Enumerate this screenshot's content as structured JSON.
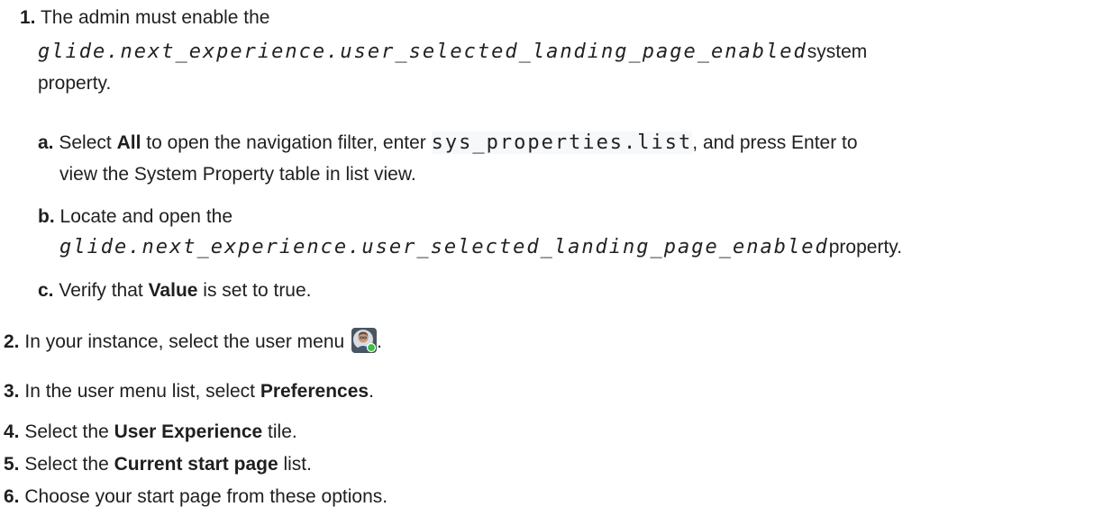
{
  "steps": {
    "s1": {
      "num": "1.",
      "text_a": "The admin must enable the",
      "property": "glide.next_experience.user_selected_landing_page_enabled",
      "text_b": "system",
      "text_c": "property."
    },
    "s1a": {
      "num": "a.",
      "pre": "Select ",
      "all": "All",
      "mid": " to open the navigation filter, enter ",
      "code": "sys_properties.list",
      "post": ", and press Enter to",
      "line2": "view the System Property table in list view."
    },
    "s1b": {
      "num": "b.",
      "text": "Locate and open the",
      "property": "glide.next_experience.user_selected_landing_page_enabled",
      "post": "property."
    },
    "s1c": {
      "num": "c.",
      "pre": "Verify that ",
      "bold": "Value",
      "post": " is set to true."
    },
    "s2": {
      "num": "2.",
      "text": "In your instance, select the user menu",
      "post": "."
    },
    "s3": {
      "num": "3.",
      "pre": "In the user menu list, select ",
      "bold": "Preferences",
      "post": "."
    },
    "s4": {
      "num": "4.",
      "pre": "Select the ",
      "bold": "User Experience",
      "post": " tile."
    },
    "s5": {
      "num": "5.",
      "pre": "Select the ",
      "bold": "Current start page",
      "post": " list."
    },
    "s6": {
      "num": "6.",
      "text": "Choose your start page from these options."
    }
  },
  "colors": {
    "avatar_status": "#3fbf3f"
  },
  "icons": {
    "user_menu": "user-avatar-icon"
  }
}
